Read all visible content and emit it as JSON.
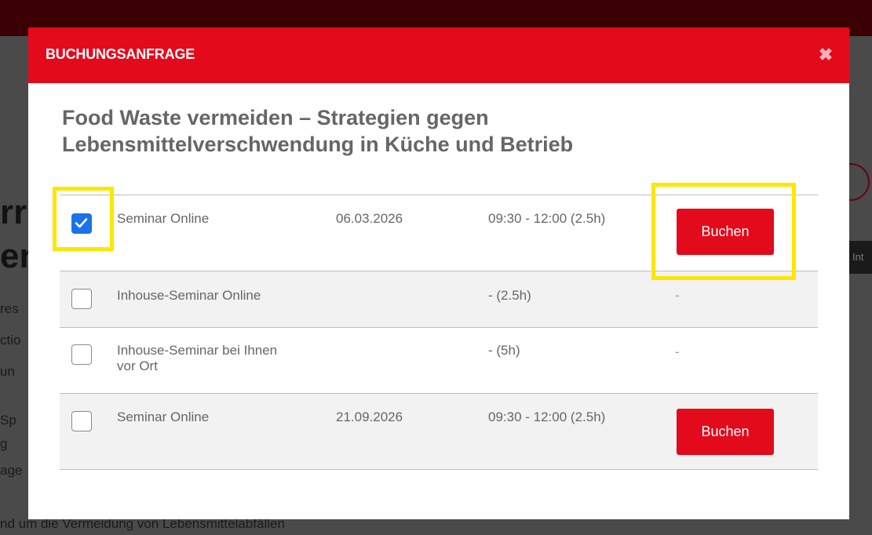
{
  "background": {
    "heading_fragment_1": "rr",
    "heading_fragment_2": "er",
    "side_text": [
      "res",
      "ctio",
      "un",
      "Sp",
      "g",
      "age"
    ],
    "footer_text": "nd um die Vermeidung von Lebensmittelabfällen",
    "side_tab_label": "Int"
  },
  "modal": {
    "header_title": "BUCHUNGSANFRAGE",
    "close_icon": "close-icon",
    "course_title": "Food Waste vermeiden – Strategien gegen Lebensmittelverschwendung in Küche und Betrieb"
  },
  "sessions": [
    {
      "checked": true,
      "type": "Seminar  Online",
      "date": "06.03.2026",
      "time": "09:30 - 12:00 (2.5h)",
      "action": "Buchen"
    },
    {
      "checked": false,
      "type": "Inhouse-Seminar  Online",
      "date": "",
      "time": "- (2.5h)",
      "action": "-"
    },
    {
      "checked": false,
      "type": "Inhouse-Seminar  bei Ihnen vor Ort",
      "date": "",
      "time": "- (5h)",
      "action": "-"
    },
    {
      "checked": false,
      "type": "Seminar  Online",
      "date": "21.09.2026",
      "time": "09:30 - 12:00 (2.5h)",
      "action": "Buchen"
    }
  ],
  "colors": {
    "brand_red": "#e30a1b",
    "checkbox_blue": "#1a73e8",
    "highlight_yellow": "#ffe600"
  }
}
